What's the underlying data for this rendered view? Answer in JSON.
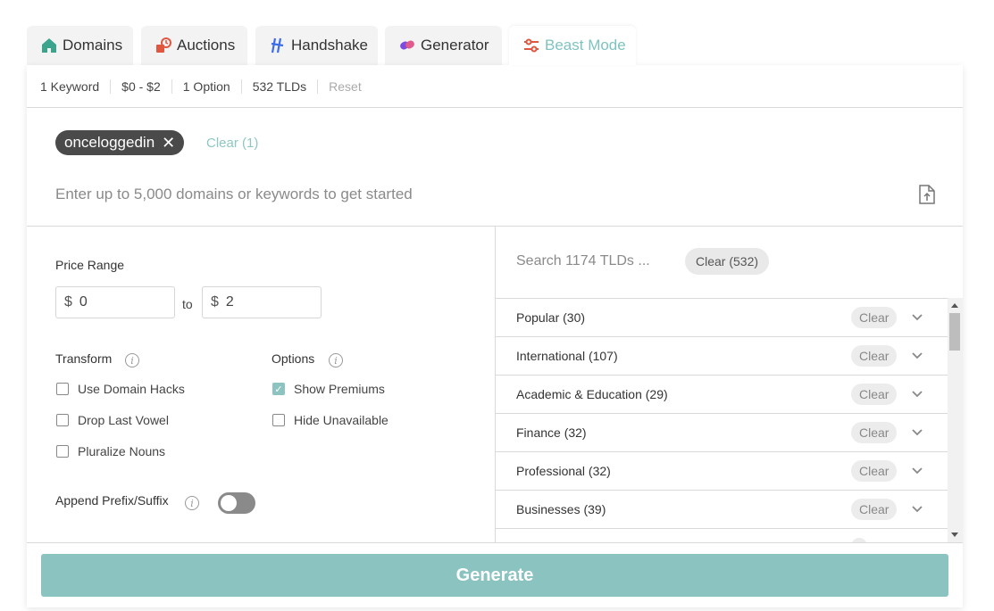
{
  "tabs": [
    {
      "label": "Domains",
      "icon": "house-icon",
      "color": "#3aa58c"
    },
    {
      "label": "Auctions",
      "icon": "gavel-icon",
      "color": "#e0563e"
    },
    {
      "label": "Handshake",
      "icon": "handshake-icon",
      "color": "#3d6ee8"
    },
    {
      "label": "Generator",
      "icon": "generator-icon",
      "color": "#7c4be0"
    },
    {
      "label": "Beast Mode",
      "icon": "sliders-icon",
      "color": "#e0563e",
      "active": true
    }
  ],
  "summary": {
    "keywords": "1 Keyword",
    "price": "$0 - $2",
    "options": "1 Option",
    "tlds": "532 TLDs",
    "reset": "Reset"
  },
  "keyword_chip": {
    "label": "onceloggedin",
    "remove": "✕"
  },
  "keyword_clear": "Clear (1)",
  "keyword_input": {
    "placeholder": "Enter up to 5,000 domains or keywords to get started",
    "value": ""
  },
  "price_range": {
    "label": "Price Range",
    "currency": "$",
    "min": "0",
    "max": "2",
    "to": "to"
  },
  "transform": {
    "label": "Transform",
    "items": [
      {
        "label": "Use Domain Hacks",
        "checked": false
      },
      {
        "label": "Drop Last Vowel",
        "checked": false
      },
      {
        "label": "Pluralize Nouns",
        "checked": false
      }
    ]
  },
  "options": {
    "label": "Options",
    "items": [
      {
        "label": "Show Premiums",
        "checked": true
      },
      {
        "label": "Hide Unavailable",
        "checked": false
      }
    ]
  },
  "append": {
    "label": "Append Prefix/Suffix",
    "enabled": false
  },
  "tld_panel": {
    "search_placeholder": "Search 1174 TLDs ...",
    "clear_all": "Clear (532)",
    "categories": [
      {
        "name": "Popular (30)",
        "clear": "Clear"
      },
      {
        "name": "International (107)",
        "clear": "Clear"
      },
      {
        "name": "Academic & Education (29)",
        "clear": "Clear"
      },
      {
        "name": "Finance (32)",
        "clear": "Clear"
      },
      {
        "name": "Professional (32)",
        "clear": "Clear"
      },
      {
        "name": "Businesses (39)",
        "clear": "Clear"
      }
    ]
  },
  "generate_label": "Generate",
  "colors": {
    "accent": "#8bc3c0",
    "chip": "#4a4a4a",
    "link": "#8fc6c3"
  }
}
